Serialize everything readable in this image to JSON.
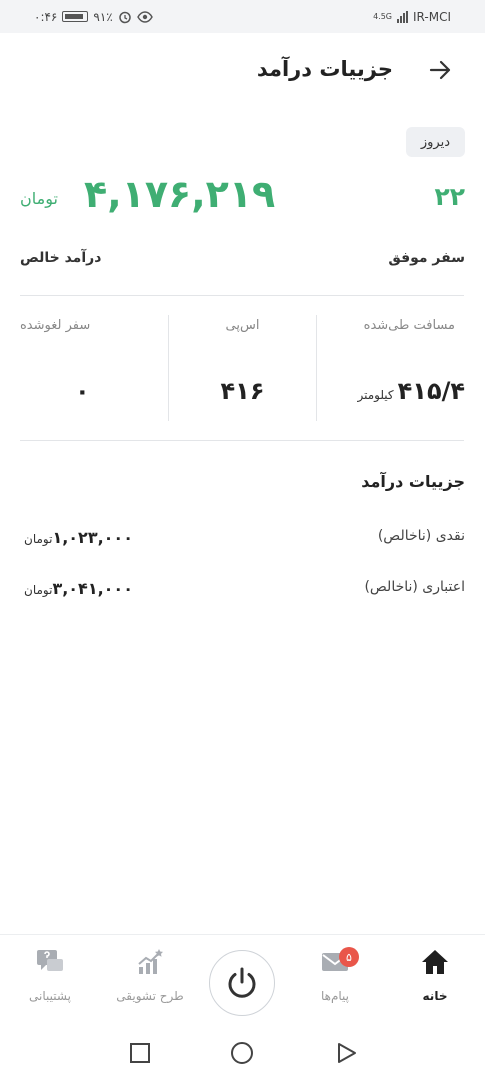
{
  "status_bar": {
    "time": "۰:۴۶",
    "battery": "۹۱٪",
    "network": "4.5G",
    "carrier": "IR-MCI"
  },
  "header": {
    "title": "جزییات درآمد",
    "back_icon": "arrow-right-icon"
  },
  "date_filter": "دیروز",
  "summary": {
    "trips_count": "۲۲",
    "trips_label": "سفر موفق",
    "net_income": "۴,۱۷۶,۲۱۹",
    "net_income_unit": "تومان",
    "net_income_label": "درآمد خالص"
  },
  "stats": [
    {
      "label": "مسافت طی‌شده",
      "value": "۴۱۵/۴",
      "unit": "کیلومتر"
    },
    {
      "label": "اس‌پی",
      "value": "۴۱۶",
      "unit": ""
    },
    {
      "label": "سفر لغوشده",
      "value": "۰",
      "unit": ""
    }
  ],
  "details": {
    "title": "جزییات درآمد",
    "rows": [
      {
        "label": "نقدی (ناخالص)",
        "value": "۱,۰۲۳,۰۰۰",
        "unit": "تومان"
      },
      {
        "label": "اعتباری (ناخالص)",
        "value": "۳,۰۴۱,۰۰۰",
        "unit": "تومان"
      }
    ]
  },
  "bottom_nav": {
    "home": "خانه",
    "messages": "پیام‌ها",
    "messages_badge": "۵",
    "incentive": "طرح تشویقی",
    "support": "پشتیبانی"
  },
  "colors": {
    "accent_green": "#3fae73",
    "badge_red": "#e9564a"
  }
}
